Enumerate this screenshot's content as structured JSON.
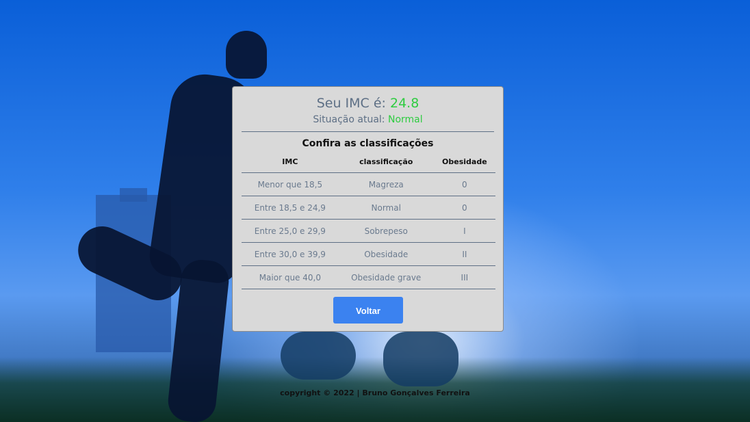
{
  "result": {
    "label": "Seu IMC é:",
    "value": "24.8",
    "situation_label": "Situação atual:",
    "situation_value": "Normal",
    "accent_color": "#2ecc40"
  },
  "table": {
    "title": "Confira as classificações",
    "headers": [
      "IMC",
      "classificação",
      "Obesidade"
    ],
    "rows": [
      [
        "Menor que 18,5",
        "Magreza",
        "0"
      ],
      [
        "Entre 18,5 e 24,9",
        "Normal",
        "0"
      ],
      [
        "Entre 25,0 e 29,9",
        "Sobrepeso",
        "I"
      ],
      [
        "Entre 30,0 e 39,9",
        "Obesidade",
        "II"
      ],
      [
        "Maior que 40,0",
        "Obesidade grave",
        "III"
      ]
    ]
  },
  "button": {
    "label": "Voltar",
    "color": "#3b82f0"
  },
  "footer": {
    "text": "copyright © 2022 | Bruno Gonçalves Ferreira"
  }
}
